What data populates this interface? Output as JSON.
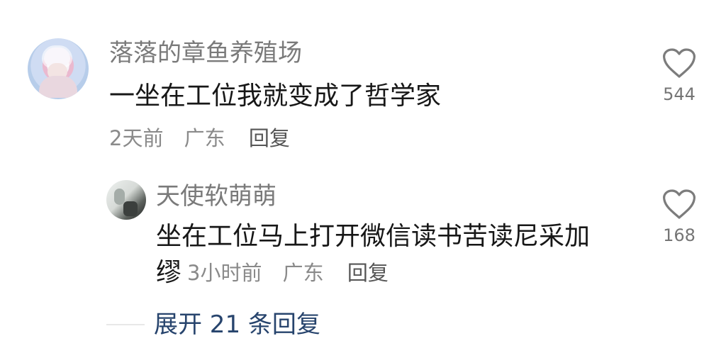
{
  "comments": [
    {
      "username": "落落的章鱼养殖场",
      "text": "一坐在工位我就变成了哲学家",
      "time": "2天前",
      "location": "广东",
      "reply_label": "回复",
      "likes": "544"
    },
    {
      "username": "天使软萌萌",
      "text_line1": "坐在工位马上打开微信读书苦读尼采加",
      "text_line2": "缪",
      "time": "3小时前",
      "location": "广东",
      "reply_label": "回复",
      "likes": "168"
    }
  ],
  "replies": {
    "expand_label": "展开 21 条回复"
  },
  "icons": {
    "main_avatar": "avatar-icon",
    "sub_avatar": "avatar-icon",
    "like": "heart-icon"
  },
  "colors": {
    "username": "#7a7a7a",
    "comment": "#171717",
    "meta": "#8a8a8a",
    "expand": "#27446d",
    "like": "#757575"
  }
}
